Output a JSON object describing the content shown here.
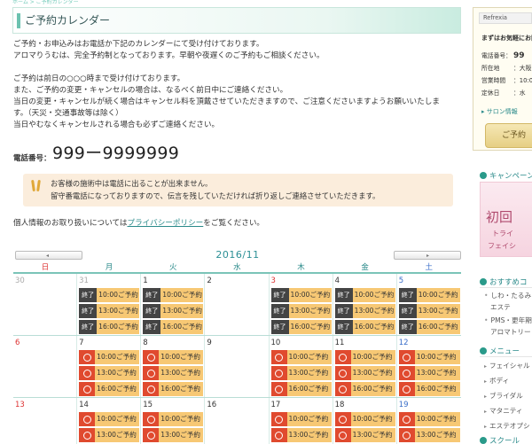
{
  "breadcrumb": "ホーム > ご予約カレンダー",
  "page_title": "ご予約カレンダー",
  "intro_lines": [
    "ご予約・お申込みはお電話か下記のカレンダーにて受け付けております。",
    "アロマりうむは、完全予約制となっております。早朝や夜遅くのご予約もご相談ください。",
    "",
    "ご予約は前日の○○○時まで受け付けております。",
    "また、ご予約の変更・キャンセルの場合は、なるべく前日中にご連絡ください。",
    "当日の変更・キャンセルが続く場合はキャンセル料を頂戴させていただきますので、ご注意くださいますようお願いいたしま",
    "す。（天災・交通事故等は除く）",
    "当日やむなくキャンセルされる場合も必ずご連絡ください。"
  ],
  "phone": {
    "label": "電話番号：",
    "number": "999ー9999999"
  },
  "notice": {
    "icon": "exclamation-icon",
    "lines": [
      "お客様の施術中は電話に出ることが出来ません。",
      "留守番電話になっておりますので、伝言を残していただければ折り返しご連絡させていただきます。"
    ]
  },
  "privacy": {
    "before": "個人情報のお取り扱いについては",
    "link": "プライバシーポリシー",
    "after": "をご覧ください。"
  },
  "calendar": {
    "month": "2016/11",
    "prev_icon": "◂",
    "next_icon": "▸",
    "weekdays": [
      "日",
      "月",
      "火",
      "水",
      "木",
      "金",
      "土"
    ],
    "weekday_colors": [
      "#d33",
      "#2a8a8a",
      "#2a8a8a",
      "#2a8a8a",
      "#2a8a8a",
      "#2a8a8a",
      "#3a6ec9"
    ],
    "weeks": [
      [
        {
          "num": "30",
          "kind": "out",
          "slots": []
        },
        {
          "num": "31",
          "kind": "out",
          "slots": [
            {
              "mark": "終了",
              "time": "10:00ご予約"
            },
            {
              "mark": "終了",
              "time": "13:00ご予約"
            },
            {
              "mark": "終了",
              "time": "16:00ご予約"
            }
          ]
        },
        {
          "num": "1",
          "kind": "",
          "slots": [
            {
              "mark": "終了",
              "time": "10:00ご予約"
            },
            {
              "mark": "終了",
              "time": "13:00ご予約"
            },
            {
              "mark": "終了",
              "time": "16:00ご予約"
            }
          ]
        },
        {
          "num": "2",
          "kind": "",
          "slots": []
        },
        {
          "num": "3",
          "kind": "hol",
          "slots": [
            {
              "mark": "終了",
              "time": "10:00ご予約"
            },
            {
              "mark": "終了",
              "time": "13:00ご予約"
            },
            {
              "mark": "終了",
              "time": "16:00ご予約"
            }
          ]
        },
        {
          "num": "4",
          "kind": "",
          "slots": [
            {
              "mark": "終了",
              "time": "10:00ご予約"
            },
            {
              "mark": "終了",
              "time": "13:00ご予約"
            },
            {
              "mark": "終了",
              "time": "16:00ご予約"
            }
          ]
        },
        {
          "num": "5",
          "kind": "sat",
          "slots": [
            {
              "mark": "終了",
              "time": "10:00ご予約"
            },
            {
              "mark": "終了",
              "time": "13:00ご予約"
            },
            {
              "mark": "終了",
              "time": "16:00ご予約"
            }
          ]
        }
      ],
      [
        {
          "num": "6",
          "kind": "sun",
          "slots": []
        },
        {
          "num": "7",
          "kind": "",
          "slots": [
            {
              "mark": "○",
              "time": "10:00ご予約"
            },
            {
              "mark": "○",
              "time": "13:00ご予約"
            },
            {
              "mark": "○",
              "time": "16:00ご予約"
            }
          ]
        },
        {
          "num": "8",
          "kind": "",
          "slots": [
            {
              "mark": "○",
              "time": "10:00ご予約"
            },
            {
              "mark": "○",
              "time": "13:00ご予約"
            },
            {
              "mark": "○",
              "time": "16:00ご予約"
            }
          ]
        },
        {
          "num": "9",
          "kind": "",
          "slots": []
        },
        {
          "num": "10",
          "kind": "",
          "slots": [
            {
              "mark": "○",
              "time": "10:00ご予約"
            },
            {
              "mark": "○",
              "time": "13:00ご予約"
            },
            {
              "mark": "○",
              "time": "16:00ご予約"
            }
          ]
        },
        {
          "num": "11",
          "kind": "",
          "slots": [
            {
              "mark": "○",
              "time": "10:00ご予約"
            },
            {
              "mark": "○",
              "time": "13:00ご予約"
            },
            {
              "mark": "○",
              "time": "16:00ご予約"
            }
          ]
        },
        {
          "num": "12",
          "kind": "sat",
          "slots": [
            {
              "mark": "○",
              "time": "10:00ご予約"
            },
            {
              "mark": "○",
              "time": "13:00ご予約"
            },
            {
              "mark": "○",
              "time": "16:00ご予約"
            }
          ]
        }
      ],
      [
        {
          "num": "13",
          "kind": "sun",
          "slots": []
        },
        {
          "num": "14",
          "kind": "",
          "slots": [
            {
              "mark": "○",
              "time": "10:00ご予約"
            },
            {
              "mark": "○",
              "time": "13:00ご予約"
            },
            {
              "mark": "○",
              "time": "16:00ご予約"
            }
          ]
        },
        {
          "num": "15",
          "kind": "",
          "slots": [
            {
              "mark": "○",
              "time": "10:00ご予約"
            },
            {
              "mark": "○",
              "time": "13:00ご予約"
            },
            {
              "mark": "○",
              "time": "16:00ご予約"
            }
          ]
        },
        {
          "num": "16",
          "kind": "",
          "slots": []
        },
        {
          "num": "17",
          "kind": "",
          "slots": [
            {
              "mark": "○",
              "time": "10:00ご予約"
            },
            {
              "mark": "○",
              "time": "13:00ご予約"
            },
            {
              "mark": "○",
              "time": "16:00ご予約"
            }
          ]
        },
        {
          "num": "18",
          "kind": "",
          "slots": [
            {
              "mark": "○",
              "time": "10:00ご予約"
            },
            {
              "mark": "○",
              "time": "13:00ご予約"
            },
            {
              "mark": "○",
              "time": "16:00ご予約"
            }
          ]
        },
        {
          "num": "19",
          "kind": "sat",
          "slots": [
            {
              "mark": "○",
              "time": "10:00ご予約"
            },
            {
              "mark": "○",
              "time": "13:00ご予約"
            },
            {
              "mark": "○",
              "time": "16:00ご予約"
            }
          ]
        }
      ]
    ]
  },
  "sidebar": {
    "shop_name": "Refrexia",
    "greeting": "まずはお気軽にお問い合わせくださいね。",
    "info": [
      {
        "label": "電話番号：",
        "value": "99"
      },
      {
        "label": "所在地",
        "value": "：大阪"
      },
      {
        "label": "営業時間",
        "value": "：10:0"
      },
      {
        "label": "定休日",
        "value": "：水"
      }
    ],
    "salon_link": "▸ サロン情報",
    "reserve_button": "ご予約",
    "campaign_title": "キャンペーン",
    "banner": {
      "a": "初回",
      "b": "トライ",
      "c": "フェイシ"
    },
    "recommend_title": "おすすめコ",
    "recommend_items": [
      "しわ・たるみ",
      "エステ",
      "PMS・更年期",
      "アロマトリー"
    ],
    "menu_title": "メニュー",
    "menu_items": [
      "フェイシャル",
      "ボディ",
      "ブライダル",
      "マタニティ",
      "エステオプシ"
    ],
    "school_title": "スクール"
  }
}
